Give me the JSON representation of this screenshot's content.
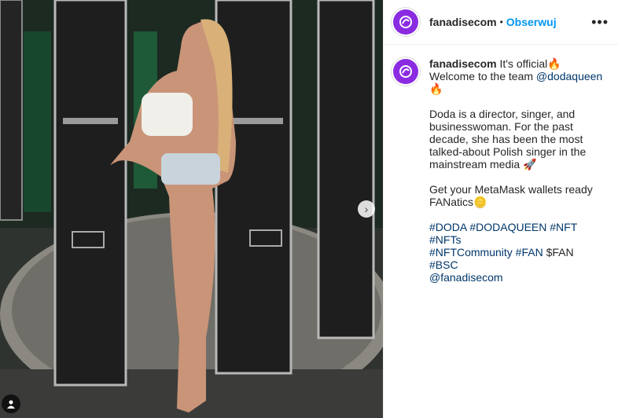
{
  "post": {
    "username": "fanadisecom",
    "dot": "•",
    "follow_label": "Obserwuj",
    "more_label": "•••"
  },
  "caption": {
    "username": "fanadisecom",
    "line1": "It's official",
    "line1_emoji": "🔥",
    "line1_cont": " Welcome to the team ",
    "mention1": "@dodaqueen",
    "line1_end_emoji": " 🔥",
    "para2": "Doda is a director, singer, and businesswoman. For the past decade, she has been the most talked-about Polish singer in the mainstream media",
    "para2_emoji": "🚀",
    "para3": "Get your MetaMask wallets ready FANatics",
    "para3_emoji": "🪙",
    "hashtags1": "#DODA #DODAQUEEN #NFT #NFTs",
    "hashtags2": "#NFTCommunity #FAN",
    "plain_tag": " $FAN ",
    "hashtags3": "#BSC",
    "mention2": "@fanadisecom"
  },
  "carousel": {
    "next_icon": "›"
  },
  "colors": {
    "link_blue": "#0095f6",
    "mention_blue": "#00376b",
    "avatar_purple": "#8a2be2"
  }
}
